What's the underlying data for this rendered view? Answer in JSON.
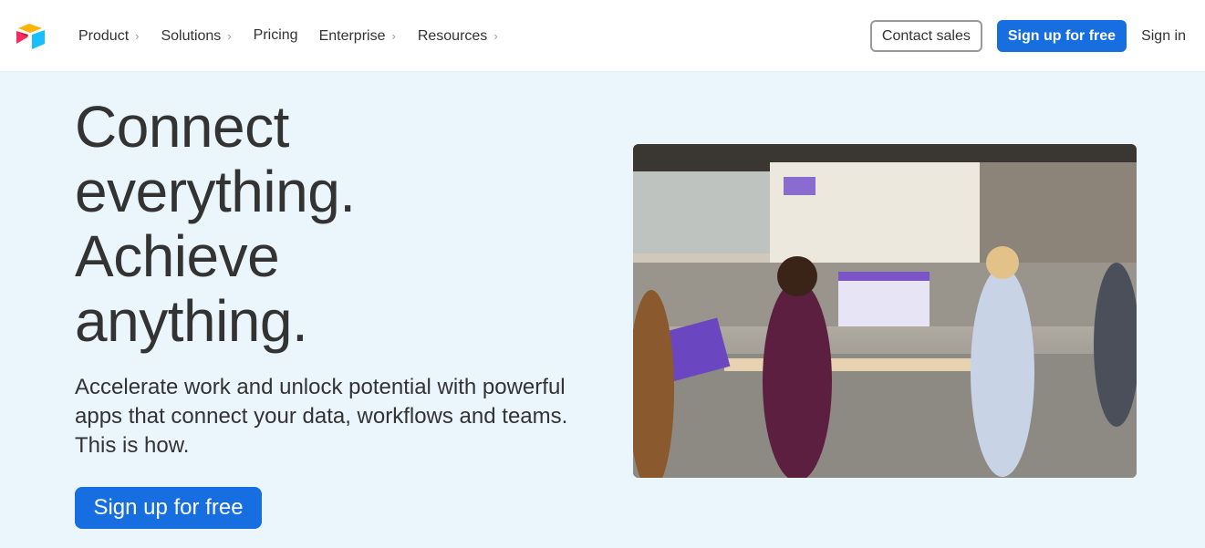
{
  "nav": {
    "logo": "airtable-logo",
    "items": [
      {
        "label": "Product",
        "has_chevron": true
      },
      {
        "label": "Solutions",
        "has_chevron": true
      },
      {
        "label": "Pricing",
        "has_chevron": false
      },
      {
        "label": "Enterprise",
        "has_chevron": true
      },
      {
        "label": "Resources",
        "has_chevron": true
      }
    ],
    "chevron": "›",
    "contact_sales": "Contact sales",
    "sign_up": "Sign up for free",
    "sign_in": "Sign in"
  },
  "hero": {
    "title_lines": [
      "Connect",
      "everything.",
      "Achieve",
      "anything."
    ],
    "subtitle": "Accelerate work and unlock potential with powerful apps that connect your data, workflows and teams. This is how.",
    "cta": "Sign up for free",
    "image": "office-team-photo"
  },
  "colors": {
    "accent": "#166ee1",
    "background": "#ebf5fc"
  }
}
